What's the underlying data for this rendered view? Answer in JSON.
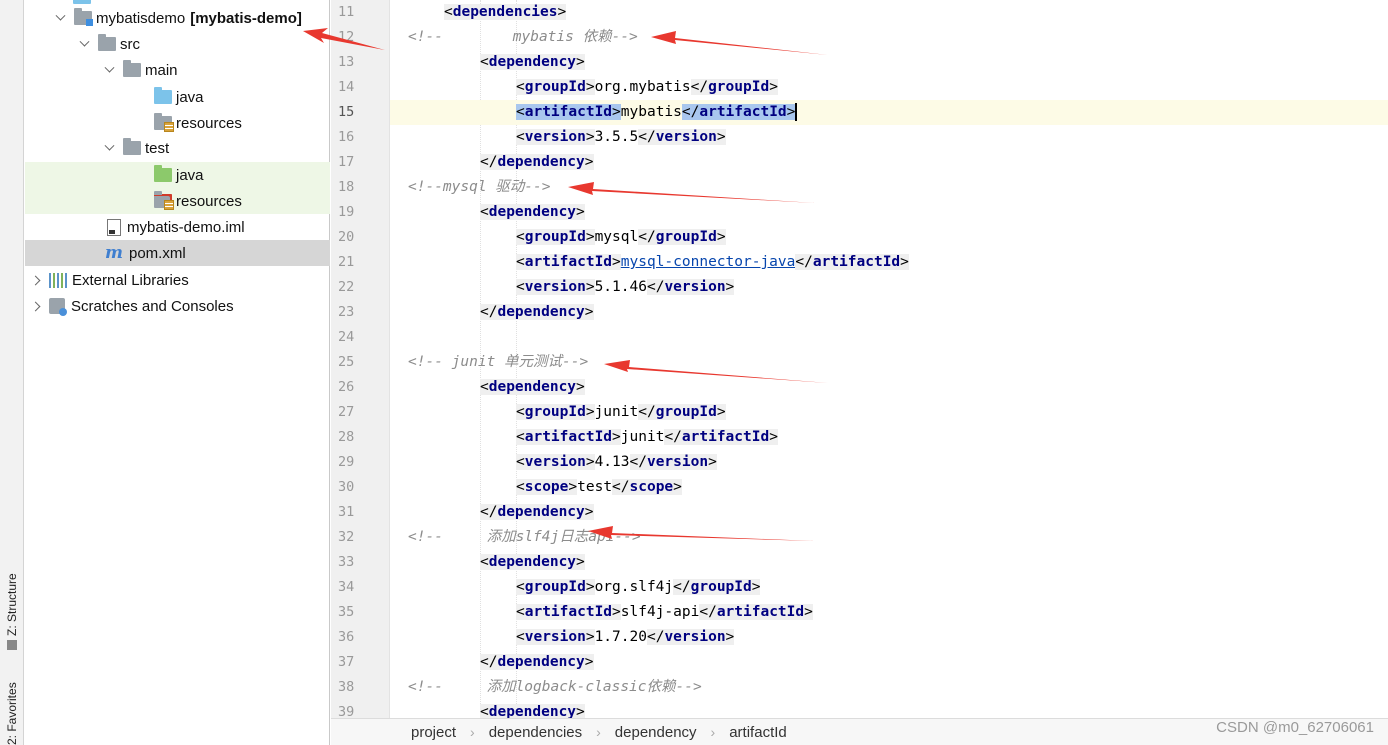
{
  "sidebar": {
    "structure_tab": "Z: Structure",
    "favorites_tab": "2: Favorites"
  },
  "tree": {
    "module_name": "mybatisdemo",
    "module_artifact": "[mybatis-demo]",
    "src": "src",
    "main": "main",
    "main_java": "java",
    "main_resources": "resources",
    "test": "test",
    "test_java": "java",
    "test_resources": "resources",
    "iml": "mybatis-demo.iml",
    "pom": "pom.xml",
    "external_libraries": "External Libraries",
    "scratches": "Scratches and Consoles"
  },
  "gutter": {
    "line_numbers": [
      "11",
      "12",
      "13",
      "14",
      "15",
      "16",
      "17",
      "18",
      "19",
      "20",
      "21",
      "22",
      "23",
      "24",
      "25",
      "26",
      "27",
      "28",
      "29",
      "30",
      "31",
      "32",
      "33",
      "34",
      "35",
      "36",
      "37",
      "38",
      "39"
    ],
    "current_line": "15"
  },
  "code": {
    "t_dependencies": "dependencies",
    "t_dependency": "dependency",
    "t_groupId": "groupId",
    "t_artifactId": "artifactId",
    "t_version": "version",
    "t_scope": "scope",
    "c1": "<!--        mybatis 依赖-->",
    "c2": "<!--mysql 驱动-->",
    "c3": "<!-- junit 单元测试-->",
    "c4": "<!--     添加slf4j日志api-->",
    "c5": "<!--     添加logback-classic依赖-->",
    "v_mybatis_group": "org.mybatis",
    "v_mybatis_artifact": "mybatis",
    "v_mybatis_version": "3.5.5",
    "v_mysql_group": "mysql",
    "v_mysql_artifact": "mysql-connector-java",
    "v_mysql_version": "5.1.46",
    "v_junit_group": "junit",
    "v_junit_artifact": "junit",
    "v_junit_version": "4.13",
    "v_junit_scope": "test",
    "v_slf4j_group": "org.slf4j",
    "v_slf4j_artifact": "slf4j-api",
    "v_slf4j_version": "1.7.20"
  },
  "breadcrumb": [
    "project",
    "dependencies",
    "dependency",
    "artifactId"
  ],
  "watermark": "CSDN @m0_62706061",
  "colors": {
    "tag_name": "#000080",
    "comment": "#8c8c8c",
    "selection": "#a9c7ee",
    "annotation_arrow": "#e8382f"
  }
}
